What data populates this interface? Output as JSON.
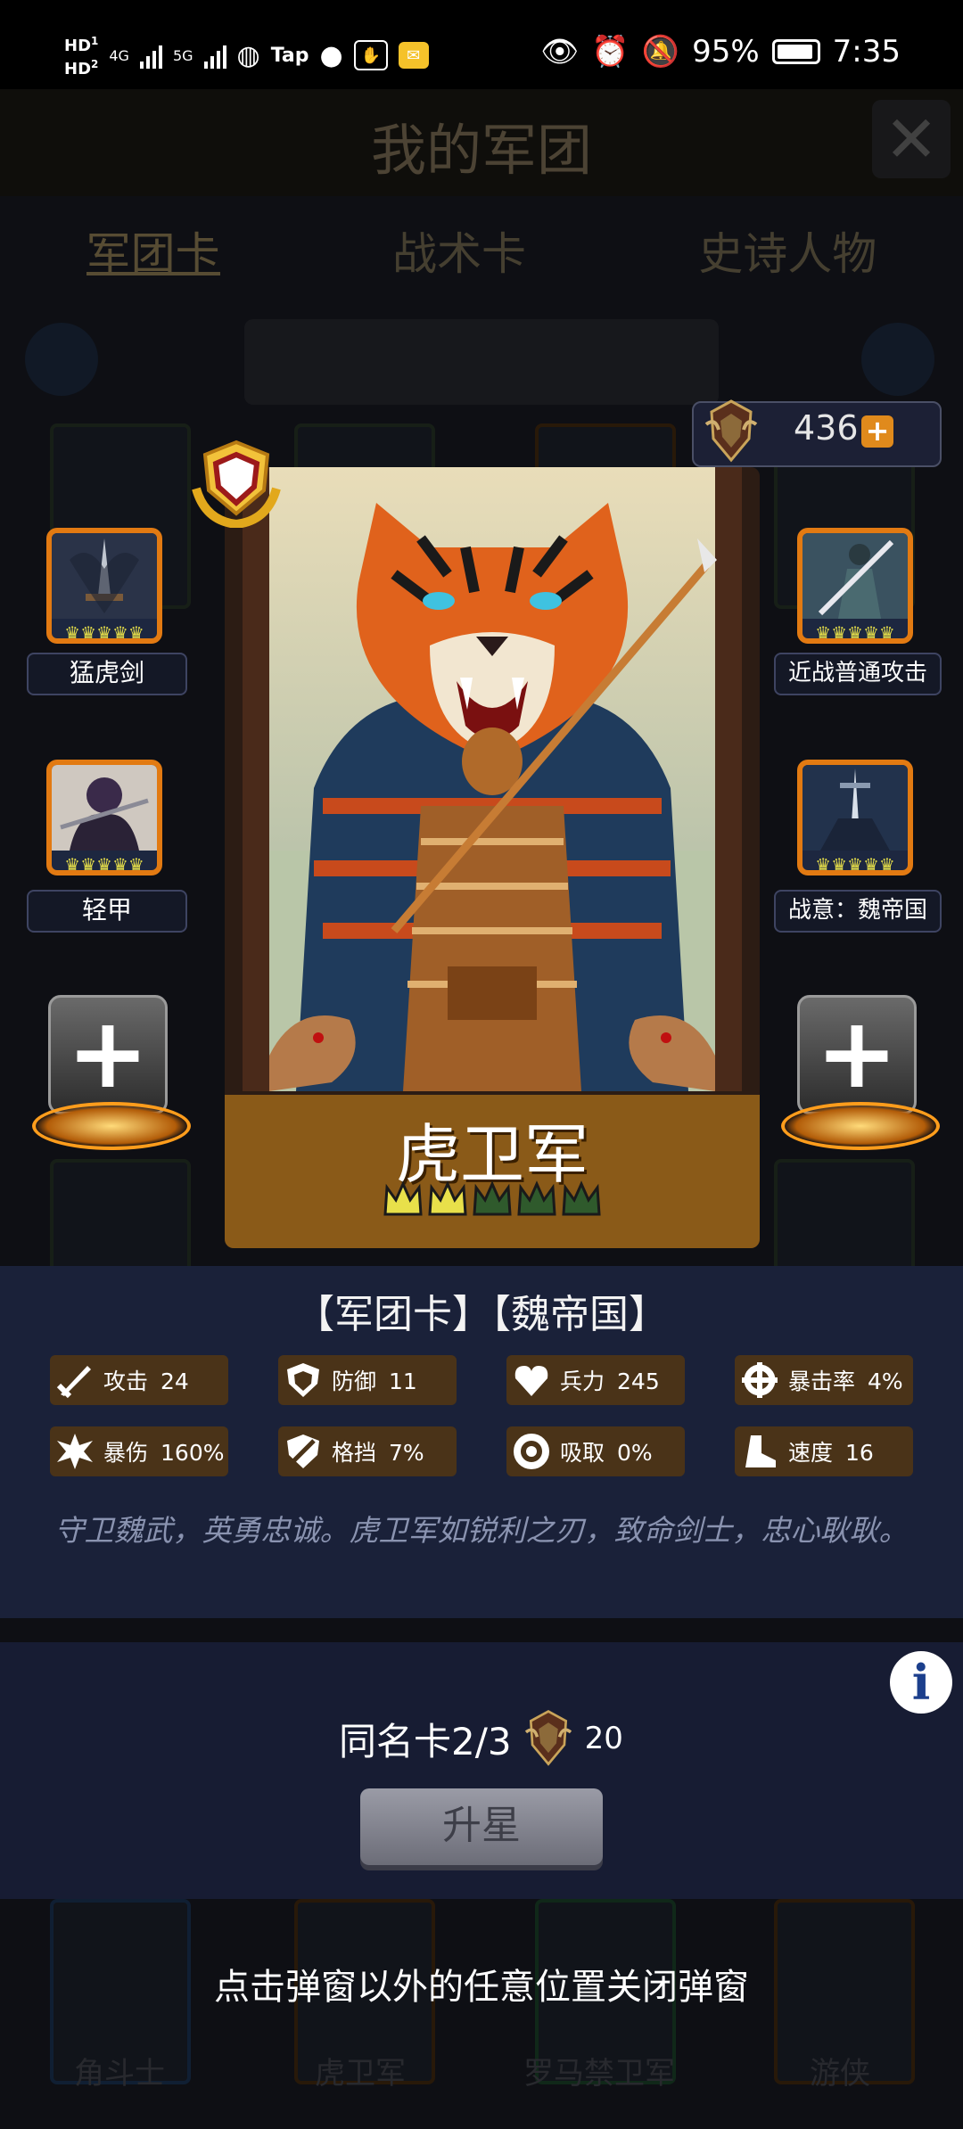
{
  "status_bar": {
    "network_tags": [
      "HD",
      "1",
      "HD",
      "2"
    ],
    "cell_1": "4G",
    "cell_2": "5G",
    "tap_label": "Tap",
    "battery": "95%",
    "time": "7:35"
  },
  "background_page": {
    "title": "我的军团",
    "tabs": [
      "军团卡",
      "战术卡",
      "史诗人物"
    ],
    "grid_labels": [
      "角斗士",
      "虎卫军",
      "罗马禁卫军",
      "游侠"
    ]
  },
  "currency": {
    "value": "436"
  },
  "card": {
    "name": "虎卫军",
    "stars_filled": 2,
    "stars_total": 5
  },
  "equipment": {
    "left": [
      {
        "label": "猛虎剑"
      },
      {
        "label": "轻甲"
      }
    ],
    "right": [
      {
        "label": "近战普通攻击"
      },
      {
        "label": "战意：魏帝国"
      }
    ],
    "add_symbol": "+"
  },
  "info": {
    "title": "【军团卡】【魏帝国】",
    "stats": [
      {
        "name": "攻击",
        "value": "24",
        "icon": "sword-icon"
      },
      {
        "name": "防御",
        "value": "11",
        "icon": "shield-icon"
      },
      {
        "name": "兵力",
        "value": "245",
        "icon": "heart-icon"
      },
      {
        "name": "暴击率",
        "value": "4%",
        "icon": "crosshair-icon"
      },
      {
        "name": "暴伤",
        "value": "160%",
        "icon": "burst-icon"
      },
      {
        "name": "格挡",
        "value": "7%",
        "icon": "block-icon"
      },
      {
        "name": "吸取",
        "value": "0%",
        "icon": "drain-icon"
      },
      {
        "name": "速度",
        "value": "16",
        "icon": "boot-icon"
      }
    ],
    "description": "守卫魏武，英勇忠诚。虎卫军如锐利之刃，致命剑士，忠心耿耿。"
  },
  "upgrade": {
    "info_symbol": "i",
    "duplicate_label": "同名卡2/3",
    "cost": "20",
    "button_label": "升星"
  },
  "close_hint": "点击弹窗以外的任意位置关闭弹窗",
  "colors": {
    "accent_orange": "#e27a12",
    "panel_blue": "#1a2139",
    "stat_bg": "#4a3318",
    "crown_filled": "#e8e04a",
    "crown_empty": "#2f5a2c"
  }
}
